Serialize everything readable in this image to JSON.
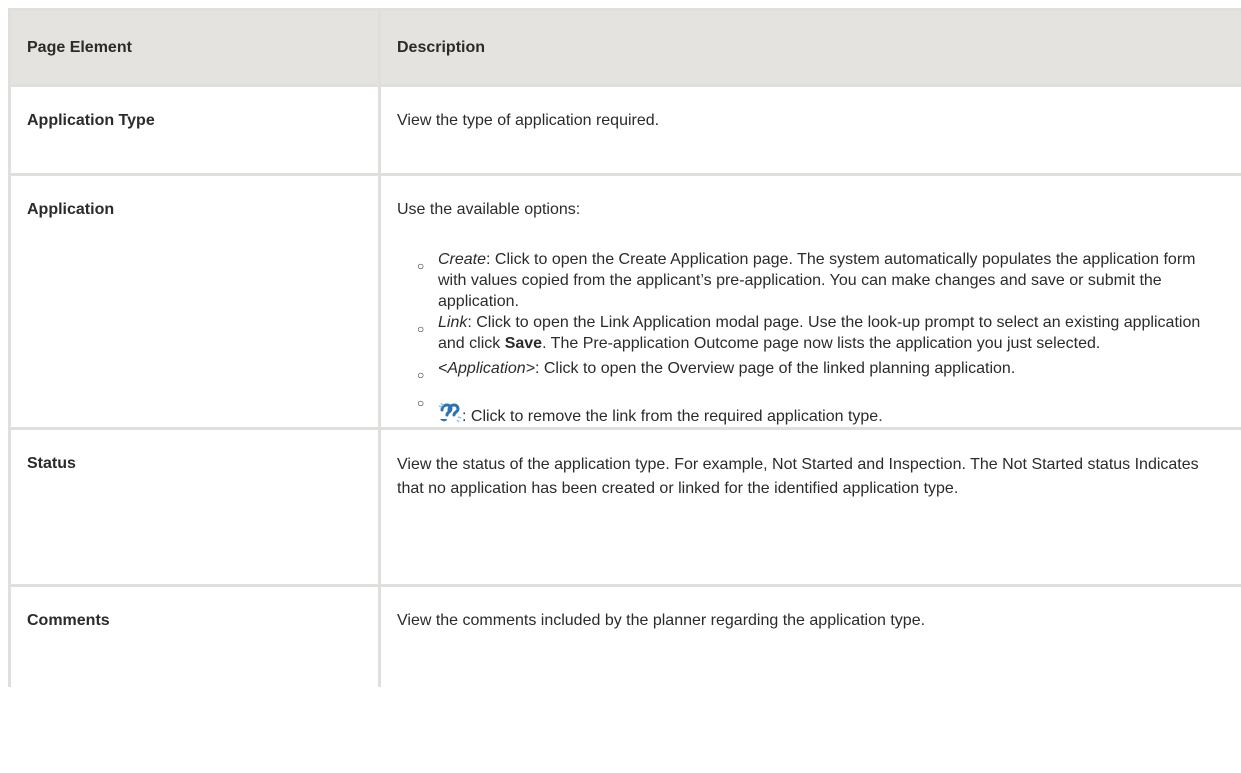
{
  "table": {
    "headers": {
      "element": "Page Element",
      "description": "Description"
    },
    "rows": {
      "application_type": {
        "element": "Application Type",
        "description": "View the type of application required."
      },
      "application": {
        "element": "Application",
        "intro": "Use the available options:",
        "options": [
          {
            "term": "Create",
            "text": ": Click to open the Create Application page. The system automatically populates the application form with values copied from the applicant’s pre-application. You can make changes and save or submit the application."
          },
          {
            "term": "Link",
            "text_before": ": Click to open the Link Application modal page. Use the look-up prompt to select an existing application and click ",
            "bold": "Save",
            "text_after": ". The Pre-application Outcome page now lists the application you just selected."
          },
          {
            "term": "<Application>",
            "text": ": Click to open the Overview page of the linked planning application."
          },
          {
            "icon": "unlink-icon",
            "text": ": Click to remove the link from the required application type."
          }
        ]
      },
      "status": {
        "element": "Status",
        "description": "View the status of the application type. For example, Not Started and Inspection. The Not Started status Indicates that no application has been created or linked for the identified application type."
      },
      "comments": {
        "element": "Comments",
        "description": "View the comments included by the planner regarding the application type."
      }
    }
  },
  "colors": {
    "header_bg": "#e5e3e0",
    "border": "#e1dfdb",
    "text": "#2b2b2b",
    "icon_blue": "#2a73b8",
    "icon_accent": "#8fc3e8"
  }
}
